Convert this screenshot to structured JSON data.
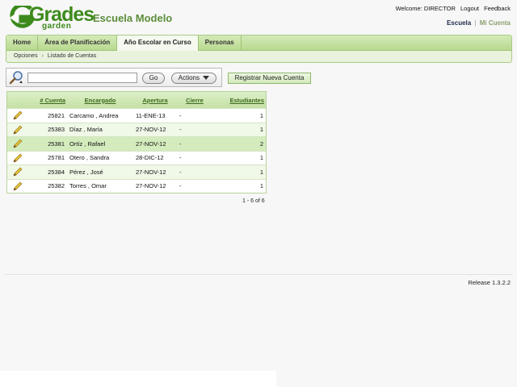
{
  "logo": {
    "line1": "Grades",
    "line2": "garden"
  },
  "school_name": "Escuela Modelo",
  "top_links": {
    "welcome": "Welcome: DIRECTOR",
    "logout": "Logout",
    "feedback": "Feedback"
  },
  "account": {
    "escuela": "Escuela",
    "separator": "|",
    "mi_cuenta": "Mi Cuenta"
  },
  "nav": {
    "tabs": [
      {
        "label": "Home"
      },
      {
        "label": "Área de Planificación"
      },
      {
        "label": "Año Escolar en Curso"
      },
      {
        "label": "Personas"
      }
    ],
    "active_tab": "Año Escolar en Curso"
  },
  "breadcrumb": {
    "item1": "Opciones",
    "chevron": "›",
    "item2": "Listado de Cuentas"
  },
  "toolbar": {
    "search_value": "",
    "go_label": "Go",
    "actions_label": "Actions",
    "register_label": "Registrar Nueva Cuenta"
  },
  "table": {
    "headers": [
      "# Cuenta",
      "Encargado",
      "Apertura",
      "Cierre",
      "Estudiantes"
    ],
    "rows": [
      {
        "cuenta": "25821",
        "encargado": "Carcamo , Andrea",
        "apertura": "11-ENE-13",
        "cierre": "-",
        "estudiantes": "1"
      },
      {
        "cuenta": "25383",
        "encargado": "Díaz , María",
        "apertura": "27-NOV-12",
        "cierre": "-",
        "estudiantes": "1"
      },
      {
        "cuenta": "25381",
        "encargado": "Ortíz , Rafael",
        "apertura": "27-NOV-12",
        "cierre": "-",
        "estudiantes": "2"
      },
      {
        "cuenta": "25781",
        "encargado": "Otero , Sandra",
        "apertura": "28-DIC-12",
        "cierre": "-",
        "estudiantes": "1"
      },
      {
        "cuenta": "25384",
        "encargado": "Pérez , José",
        "apertura": "27-NOV-12",
        "cierre": "-",
        "estudiantes": "1"
      },
      {
        "cuenta": "25382",
        "encargado": "Torres , Omar",
        "apertura": "27-NOV-12",
        "cierre": "-",
        "estudiantes": "1"
      }
    ],
    "pagination": "1 - 6 of 6"
  },
  "release": "Release 1.3.2.2",
  "icons": {
    "search": "magnifier-icon",
    "edit": "pencil-icon",
    "actions": "dropdown-triangle-icon"
  },
  "colors": {
    "brand_green": "#3c8a1c",
    "nav_green": "#b8d98f",
    "highlight_row": "#d4ebbd"
  }
}
